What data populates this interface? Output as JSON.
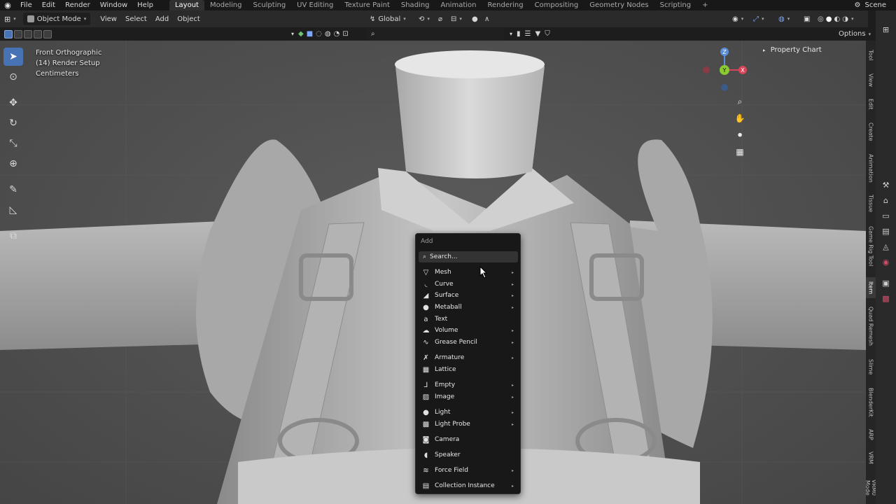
{
  "topbar": {
    "menus": [
      "File",
      "Edit",
      "Render",
      "Window",
      "Help"
    ],
    "workspaces": [
      "Layout",
      "Modeling",
      "Sculpting",
      "UV Editing",
      "Texture Paint",
      "Shading",
      "Animation",
      "Rendering",
      "Compositing",
      "Geometry Nodes",
      "Scripting"
    ],
    "active_workspace": "Layout",
    "add_workspace": "+",
    "scene": "Scene"
  },
  "header": {
    "mode": "Object Mode",
    "menus": [
      "View",
      "Select",
      "Add",
      "Object"
    ],
    "transform_orientation": "Global",
    "options": "Options"
  },
  "viewport_info": {
    "view": "Front Orthographic",
    "collection": "(14) Render Setup",
    "units": "Centimeters"
  },
  "gizmo": {
    "z": "Z",
    "y": "Y",
    "x": "X"
  },
  "property_chart": "Property Chart",
  "side_tabs": [
    "Tool",
    "View",
    "Edit",
    "Create",
    "Animation",
    "Tissue",
    "Game Rig Tool",
    "Item",
    "Quad Remesh",
    "Slime",
    "BlenderKit",
    "ARP",
    "VRM",
    "VRM0 Mode"
  ],
  "active_side_tab": "Item",
  "add_menu": {
    "title": "Add",
    "search": "Search...",
    "items": [
      {
        "label": "Mesh",
        "submenu": true
      },
      {
        "label": "Curve",
        "submenu": true
      },
      {
        "label": "Surface",
        "submenu": true
      },
      {
        "label": "Metaball",
        "submenu": true
      },
      {
        "label": "Text",
        "submenu": false
      },
      {
        "label": "Volume",
        "submenu": true
      },
      {
        "label": "Grease Pencil",
        "submenu": true
      },
      {
        "label": "Armature",
        "submenu": true
      },
      {
        "label": "Lattice",
        "submenu": false
      },
      {
        "label": "Empty",
        "submenu": true
      },
      {
        "label": "Image",
        "submenu": true
      },
      {
        "label": "Light",
        "submenu": true
      },
      {
        "label": "Light Probe",
        "submenu": true
      },
      {
        "label": "Camera",
        "submenu": false
      },
      {
        "label": "Speaker",
        "submenu": false
      },
      {
        "label": "Force Field",
        "submenu": true
      },
      {
        "label": "Collection Instance",
        "submenu": true
      }
    ],
    "submenu_glyph": "▸"
  }
}
